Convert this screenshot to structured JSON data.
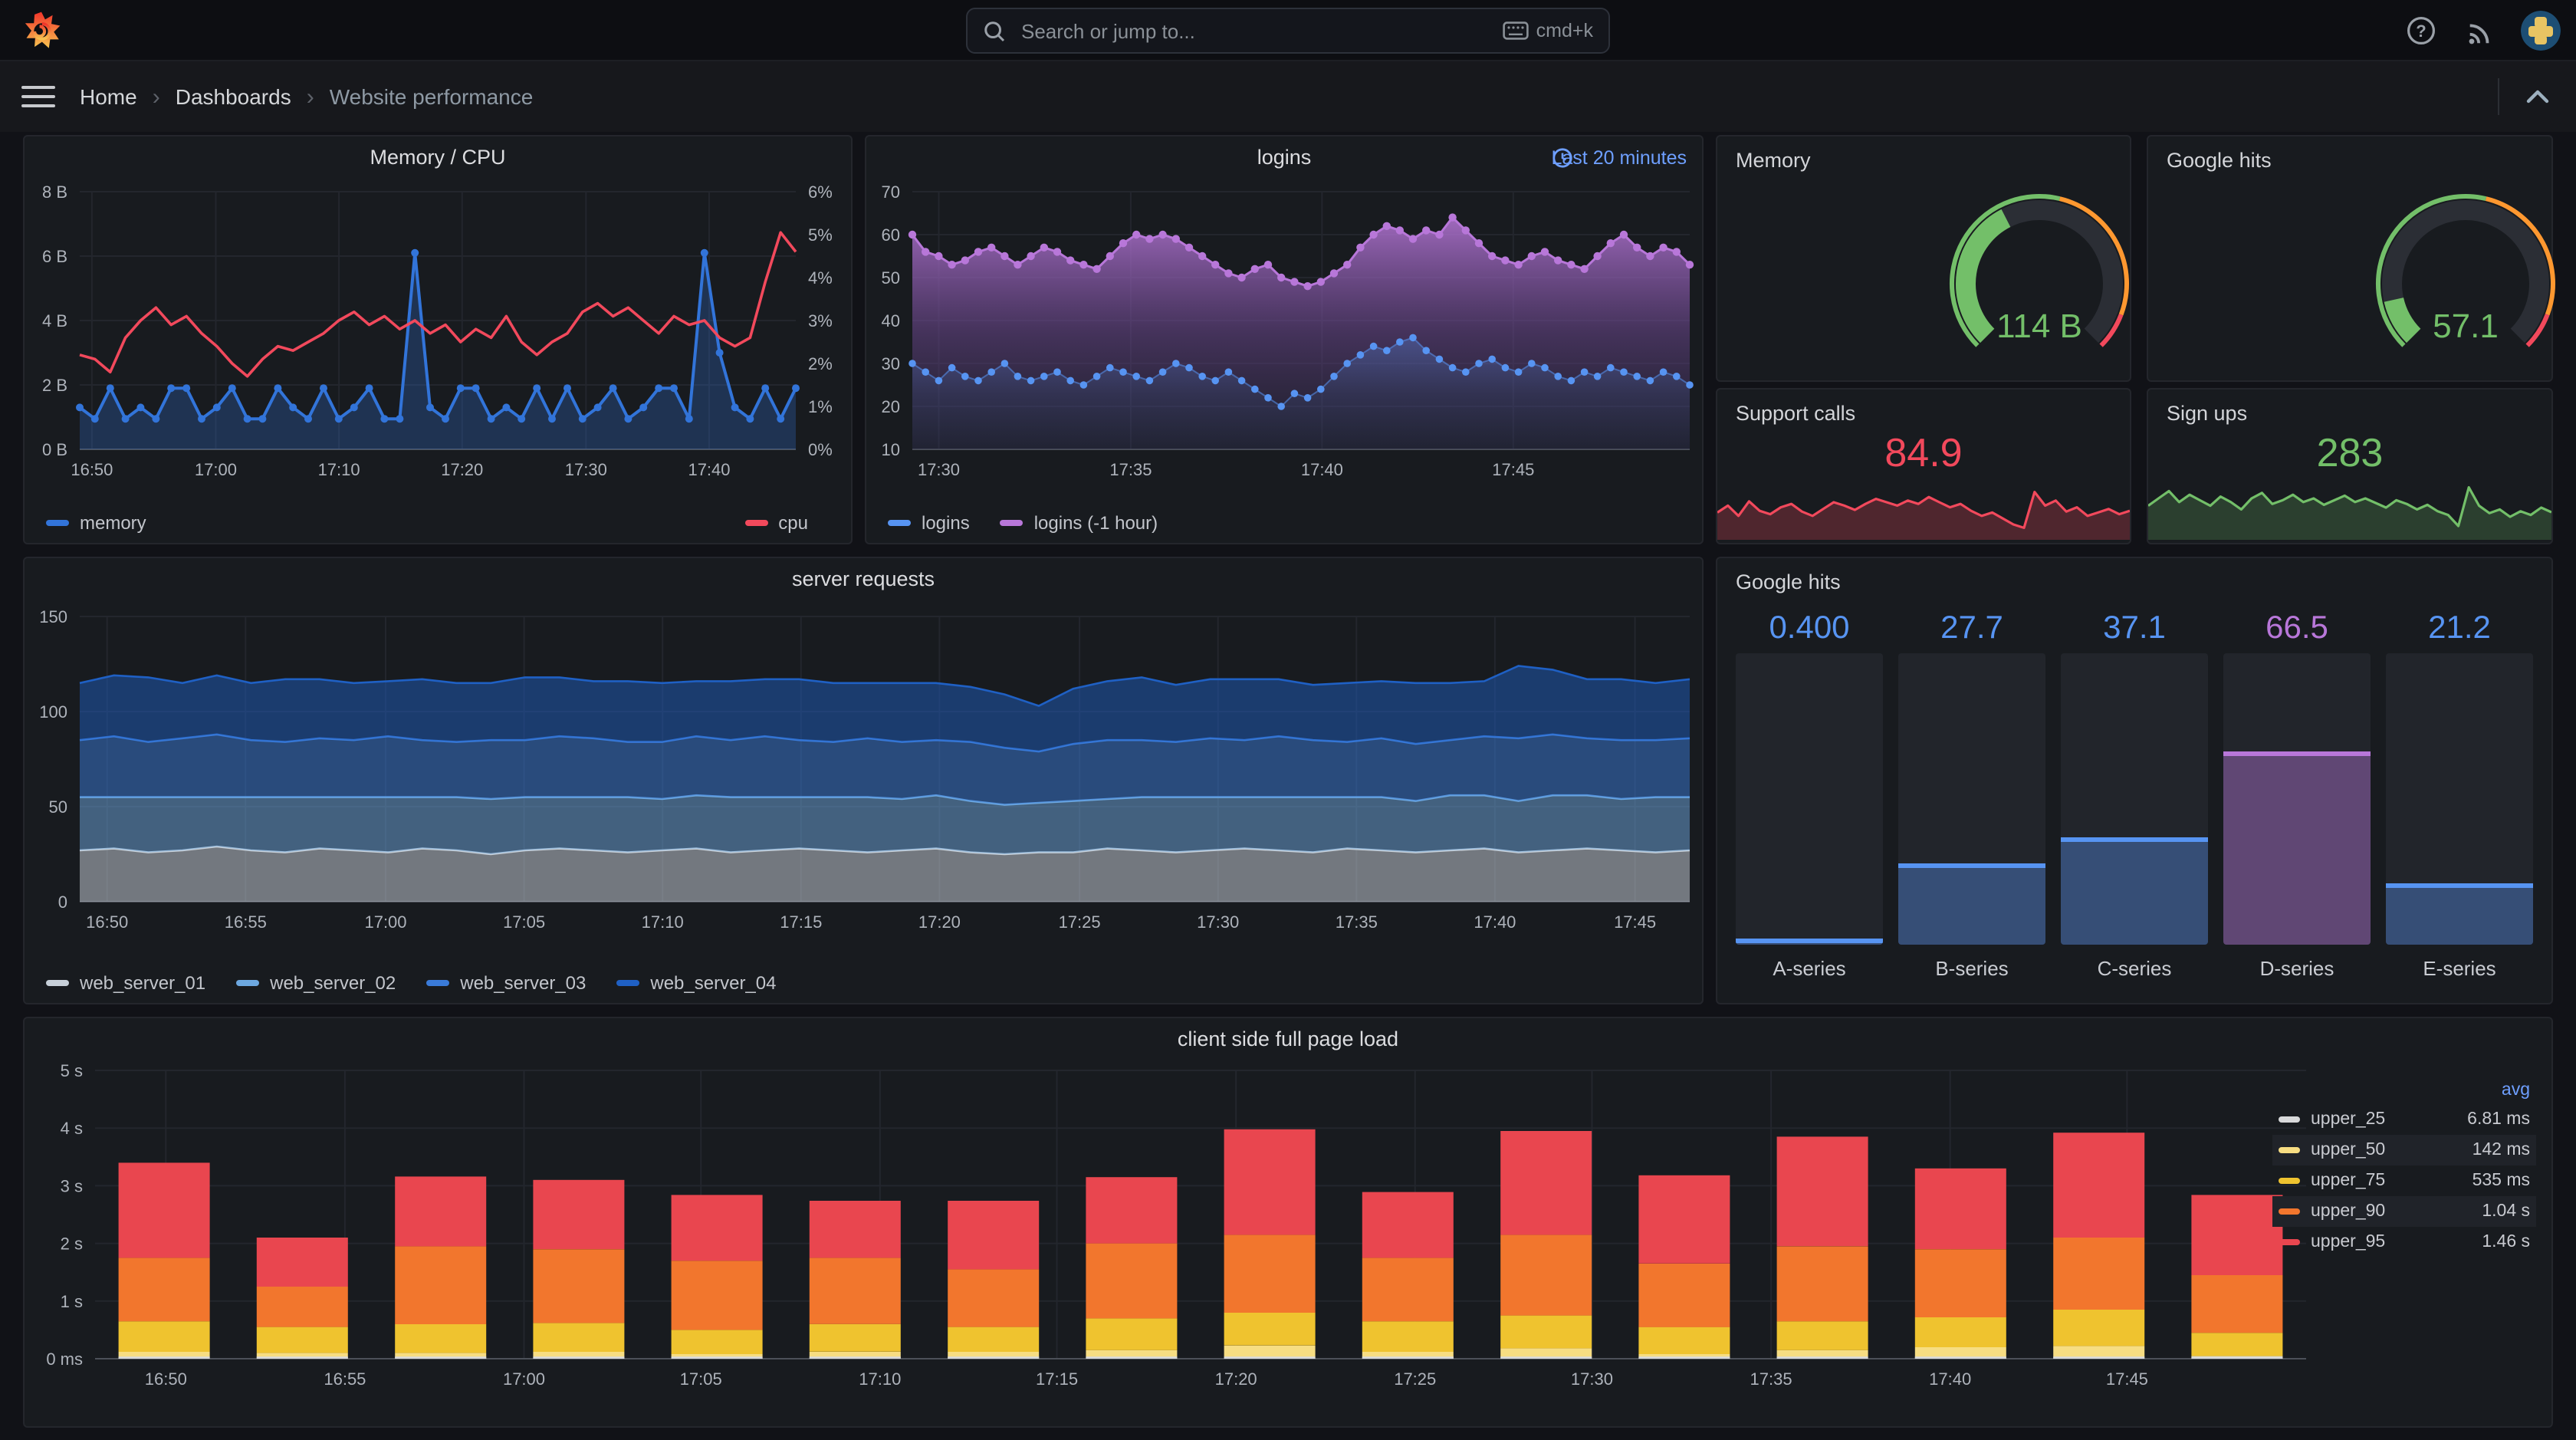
{
  "topbar": {
    "search_placeholder": "Search or jump to...",
    "shortcut": "cmd+k"
  },
  "breadcrumb": {
    "items": [
      "Home",
      "Dashboards",
      "Website performance"
    ]
  },
  "colors": {
    "blue": "#3274D9",
    "light_blue": "#5794F2",
    "red": "#F2495C",
    "green": "#73BF69",
    "orange": "#FF9830",
    "purple": "#B877D9",
    "panel": "#181B1F",
    "background": "#111217"
  },
  "chart_data": [
    {
      "id": "memcpu",
      "type": "line",
      "title": "Memory / CPU",
      "ylim": [
        0,
        8
      ],
      "yticks": [
        {
          "v": 8,
          "l": "8 B"
        },
        {
          "v": 6,
          "l": "6 B"
        },
        {
          "v": 4,
          "l": "4 B"
        },
        {
          "v": 2,
          "l": "2 B"
        },
        {
          "v": 0,
          "l": "0 B"
        }
      ],
      "y2lim": [
        0,
        6
      ],
      "y2ticks": [
        {
          "v": 6,
          "l": "6%"
        },
        {
          "v": 5,
          "l": "5%"
        },
        {
          "v": 4,
          "l": "4%"
        },
        {
          "v": 3,
          "l": "3%"
        },
        {
          "v": 2,
          "l": "2%"
        },
        {
          "v": 1,
          "l": "1%"
        },
        {
          "v": 0,
          "l": "0%"
        }
      ],
      "xticks": [
        {
          "f": 0.017,
          "l": "16:50"
        },
        {
          "f": 0.19,
          "l": "17:00"
        },
        {
          "f": 0.362,
          "l": "17:10"
        },
        {
          "f": 0.534,
          "l": "17:20"
        },
        {
          "f": 0.707,
          "l": "17:30"
        },
        {
          "f": 0.879,
          "l": "17:40"
        }
      ],
      "series": [
        {
          "name": "memory",
          "color": "#3274D9",
          "axis": 1,
          "dots": true,
          "lw": 2,
          "fill": "rgba(50,116,217,0.28)",
          "values": [
            1.3,
            0.95,
            1.9,
            0.95,
            1.3,
            0.95,
            1.9,
            1.9,
            0.95,
            1.3,
            1.9,
            0.95,
            0.95,
            1.9,
            1.3,
            0.95,
            1.9,
            0.95,
            1.3,
            1.9,
            0.95,
            0.95,
            6.1,
            1.3,
            0.95,
            1.9,
            1.9,
            0.95,
            1.3,
            0.95,
            1.9,
            0.95,
            1.9,
            0.95,
            1.3,
            1.9,
            0.95,
            1.3,
            1.9,
            1.9,
            0.95,
            6.1,
            3.0,
            1.3,
            0.95,
            1.9,
            0.95,
            1.9
          ]
        },
        {
          "name": "cpu",
          "color": "#F2495C",
          "axis": 2,
          "lw": 1.8,
          "values": [
            2.2,
            2.1,
            1.8,
            2.6,
            3.0,
            3.3,
            2.9,
            3.1,
            2.7,
            2.4,
            2.0,
            1.7,
            2.1,
            2.4,
            2.3,
            2.5,
            2.7,
            3.0,
            3.2,
            2.9,
            3.1,
            2.8,
            3.0,
            2.7,
            2.9,
            2.5,
            2.8,
            2.6,
            3.1,
            2.5,
            2.2,
            2.5,
            2.7,
            3.2,
            3.4,
            3.1,
            3.3,
            3.0,
            2.7,
            3.1,
            2.9,
            3.0,
            2.6,
            2.4,
            2.6,
            3.9,
            5.05,
            4.6
          ]
        }
      ],
      "legend_left": [
        {
          "label": "memory",
          "color": "#3274D9"
        }
      ],
      "legend_right": [
        {
          "label": "cpu",
          "color": "#F2495C"
        }
      ]
    },
    {
      "id": "logins",
      "type": "line",
      "title": "logins",
      "timerange": "Last 20 minutes",
      "ylim": [
        10,
        70
      ],
      "yticks": [
        {
          "v": 70,
          "l": "70"
        },
        {
          "v": 60,
          "l": "60"
        },
        {
          "v": 50,
          "l": "50"
        },
        {
          "v": 40,
          "l": "40"
        },
        {
          "v": 30,
          "l": "30"
        },
        {
          "v": 20,
          "l": "20"
        },
        {
          "v": 10,
          "l": "10"
        }
      ],
      "xticks": [
        {
          "f": 0.034,
          "l": "17:30"
        },
        {
          "f": 0.281,
          "l": "17:35"
        },
        {
          "f": 0.527,
          "l": "17:40"
        },
        {
          "f": 0.773,
          "l": "17:45"
        }
      ],
      "series": [
        {
          "name": "logins (-1 hour)",
          "color": "#B877D9",
          "dots": true,
          "r": 2.6,
          "lw": 1.5,
          "gradfill": [
            "rgba(184,119,217,0.85)",
            "rgba(105,70,140,0.55)",
            "rgba(45,40,70,0.35)"
          ],
          "values": [
            60,
            56,
            55,
            53,
            54,
            56,
            57,
            55,
            53,
            55,
            57,
            56,
            54,
            53,
            52,
            55,
            58,
            60,
            59,
            60,
            59,
            57,
            55,
            53,
            51,
            50,
            52,
            53,
            50,
            49,
            48,
            49,
            51,
            53,
            57,
            60,
            62,
            61,
            59,
            61,
            60,
            64,
            61,
            58,
            55,
            54,
            53,
            55,
            56,
            54,
            53,
            52,
            55,
            58,
            60,
            57,
            55,
            57,
            56,
            53
          ]
        },
        {
          "name": "logins",
          "color": "#5794F2",
          "dots": true,
          "r": 2.4,
          "lw": 1,
          "lo": 0.55,
          "gradfill": [
            "rgba(87,148,242,0.30)",
            "rgba(87,148,242,0.10)",
            "rgba(87,148,242,0.03)"
          ],
          "values": [
            30,
            28,
            26,
            29,
            27,
            26,
            28,
            30,
            27,
            26,
            27,
            28,
            26,
            25,
            27,
            29,
            28,
            27,
            26,
            28,
            30,
            29,
            27,
            26,
            28,
            26,
            24,
            22,
            20,
            23,
            22,
            24,
            27,
            30,
            32,
            34,
            33,
            35,
            36,
            33,
            31,
            29,
            28,
            30,
            31,
            29,
            28,
            30,
            29,
            27,
            26,
            28,
            27,
            29,
            28,
            27,
            26,
            28,
            27,
            25
          ]
        }
      ],
      "legend": [
        {
          "label": "logins",
          "color": "#5794F2"
        },
        {
          "label": "logins (-1 hour)",
          "color": "#B877D9"
        }
      ]
    },
    {
      "id": "server",
      "type": "stacked-area",
      "title": "server requests",
      "ylim": [
        0,
        150
      ],
      "yticks": [
        {
          "v": 150,
          "l": "150"
        },
        {
          "v": 100,
          "l": "100"
        },
        {
          "v": 50,
          "l": "50"
        },
        {
          "v": 0,
          "l": "0"
        }
      ],
      "xticks": [
        {
          "f": 0.017,
          "l": "16:50"
        },
        {
          "f": 0.103,
          "l": "16:55"
        },
        {
          "f": 0.19,
          "l": "17:00"
        },
        {
          "f": 0.276,
          "l": "17:05"
        },
        {
          "f": 0.362,
          "l": "17:10"
        },
        {
          "f": 0.448,
          "l": "17:15"
        },
        {
          "f": 0.534,
          "l": "17:20"
        },
        {
          "f": 0.621,
          "l": "17:25"
        },
        {
          "f": 0.707,
          "l": "17:30"
        },
        {
          "f": 0.793,
          "l": "17:35"
        },
        {
          "f": 0.879,
          "l": "17:40"
        },
        {
          "f": 0.966,
          "l": "17:45"
        }
      ],
      "series": [
        {
          "name": "web_server_01",
          "color": "#C7D0D9",
          "fill": "rgba(199,208,217,0.52)",
          "values": [
            27,
            28,
            26,
            27,
            29,
            27,
            26,
            28,
            27,
            26,
            28,
            27,
            25,
            27,
            28,
            27,
            26,
            27,
            28,
            26,
            27,
            28,
            27,
            26,
            27,
            28,
            26,
            25,
            26,
            26,
            28,
            27,
            26,
            27,
            28,
            27,
            26,
            28,
            27,
            26,
            27,
            28,
            26,
            27,
            28,
            27,
            26,
            27
          ]
        },
        {
          "name": "web_server_02",
          "color": "#6DA8E0",
          "fill": "rgba(109,168,224,0.5)",
          "values": [
            28,
            27,
            29,
            28,
            26,
            28,
            29,
            27,
            28,
            29,
            27,
            28,
            29,
            28,
            27,
            28,
            29,
            27,
            28,
            29,
            28,
            27,
            28,
            29,
            27,
            28,
            27,
            26,
            26,
            27,
            26,
            28,
            29,
            28,
            27,
            28,
            29,
            27,
            28,
            27,
            29,
            28,
            27,
            29,
            28,
            27,
            29,
            28
          ]
        },
        {
          "name": "web_server_03",
          "color": "#3A7BD9",
          "fill": "rgba(58,123,217,0.5)",
          "values": [
            30,
            32,
            29,
            31,
            33,
            30,
            29,
            31,
            30,
            32,
            30,
            29,
            31,
            30,
            32,
            31,
            29,
            30,
            31,
            30,
            32,
            30,
            29,
            31,
            30,
            29,
            31,
            30,
            27,
            30,
            31,
            30,
            29,
            31,
            30,
            32,
            30,
            29,
            31,
            30,
            29,
            31,
            33,
            32,
            30,
            31,
            30,
            31
          ]
        },
        {
          "name": "web_server_04",
          "color": "#1F60C4",
          "fill": "rgba(31,96,196,0.48)",
          "values": [
            30,
            32,
            34,
            29,
            31,
            30,
            33,
            31,
            30,
            29,
            32,
            31,
            30,
            33,
            31,
            30,
            32,
            31,
            29,
            31,
            30,
            32,
            31,
            29,
            31,
            30,
            29,
            28,
            24,
            29,
            31,
            33,
            30,
            31,
            32,
            30,
            29,
            31,
            30,
            32,
            30,
            29,
            38,
            34,
            31,
            32,
            30,
            31
          ]
        }
      ],
      "legend": [
        {
          "label": "web_server_01",
          "color": "#C7D0D9"
        },
        {
          "label": "web_server_02",
          "color": "#6DA8E0"
        },
        {
          "label": "web_server_03",
          "color": "#3A7BD9"
        },
        {
          "label": "web_server_04",
          "color": "#1F60C4"
        }
      ]
    },
    {
      "id": "gauge-memory",
      "type": "gauge",
      "title": "Memory",
      "value": "114 B",
      "percent": 40,
      "color": "#73BF69",
      "thresholds": [
        {
          "to": 55,
          "color": "#73BF69"
        },
        {
          "to": 91,
          "color": "#FF9830"
        },
        {
          "to": 100,
          "color": "#F2495C"
        }
      ]
    },
    {
      "id": "gauge-google",
      "type": "gauge",
      "title": "Google hits",
      "value": "57.1",
      "percent": 12,
      "color": "#73BF69",
      "thresholds": [
        {
          "to": 55,
          "color": "#73BF69"
        },
        {
          "to": 91,
          "color": "#FF9830"
        },
        {
          "to": 100,
          "color": "#F2495C"
        }
      ]
    },
    {
      "id": "stat-support",
      "type": "stat-sparkline",
      "title": "Support calls",
      "value": "84.9",
      "color": "#F2495C",
      "fill": "rgba(242,73,92,0.25)",
      "ylim": [
        30,
        100
      ],
      "values": [
        62,
        70,
        58,
        75,
        64,
        60,
        68,
        72,
        63,
        58,
        66,
        74,
        70,
        65,
        72,
        78,
        74,
        70,
        76,
        72,
        80,
        74,
        68,
        72,
        64,
        58,
        62,
        55,
        48,
        44,
        86,
        70,
        76,
        63,
        68,
        58,
        62,
        66,
        60,
        64
      ]
    },
    {
      "id": "stat-signups",
      "type": "stat-sparkline",
      "title": "Sign ups",
      "value": "283",
      "color": "#73BF69",
      "fill": "rgba(115,191,105,0.22)",
      "ylim": [
        15,
        80
      ],
      "values": [
        52,
        60,
        68,
        56,
        64,
        58,
        52,
        62,
        56,
        48,
        60,
        66,
        54,
        58,
        64,
        56,
        60,
        53,
        58,
        63,
        56,
        60,
        55,
        50,
        58,
        54,
        48,
        53,
        46,
        42,
        30,
        72,
        52,
        44,
        48,
        40,
        46,
        42,
        50,
        45
      ]
    },
    {
      "id": "bargauge",
      "type": "bar",
      "title": "Google hits",
      "max": 100,
      "bars": [
        {
          "label": "A-series",
          "display": "0.400",
          "value": 0.4,
          "color": "#5794F2",
          "body": "rgba(87,148,242,0.38)"
        },
        {
          "label": "B-series",
          "display": "27.7",
          "value": 27.7,
          "color": "#5794F2",
          "body": "rgba(87,148,242,0.38)"
        },
        {
          "label": "C-series",
          "display": "37.1",
          "value": 37.1,
          "color": "#5794F2",
          "body": "rgba(87,148,242,0.38)"
        },
        {
          "label": "D-series",
          "display": "66.5",
          "value": 66.5,
          "color": "#B877D9",
          "body": "rgba(184,119,217,0.42)"
        },
        {
          "label": "E-series",
          "display": "21.2",
          "value": 21.2,
          "color": "#5794F2",
          "body": "rgba(87,148,242,0.38)"
        }
      ]
    },
    {
      "id": "pageload",
      "type": "stacked-bar",
      "title": "client side full page load",
      "ylim": [
        0,
        5
      ],
      "yticks": [
        {
          "v": 5,
          "l": "5 s"
        },
        {
          "v": 4,
          "l": "4 s"
        },
        {
          "v": 3,
          "l": "3 s"
        },
        {
          "v": 2,
          "l": "2 s"
        },
        {
          "v": 1,
          "l": "1 s"
        },
        {
          "v": 0,
          "l": "0 ms"
        }
      ],
      "xticks": [
        {
          "f": 0.032,
          "l": "16:50"
        },
        {
          "f": 0.113,
          "l": "16:55"
        },
        {
          "f": 0.194,
          "l": "17:00"
        },
        {
          "f": 0.274,
          "l": "17:05"
        },
        {
          "f": 0.355,
          "l": "17:10"
        },
        {
          "f": 0.435,
          "l": "17:15"
        },
        {
          "f": 0.516,
          "l": "17:20"
        },
        {
          "f": 0.597,
          "l": "17:25"
        },
        {
          "f": 0.677,
          "l": "17:30"
        },
        {
          "f": 0.758,
          "l": "17:35"
        },
        {
          "f": 0.839,
          "l": "17:40"
        },
        {
          "f": 0.919,
          "l": "17:45"
        }
      ],
      "colors": {
        "u25": "#D8D9DA",
        "u50": "#F7DD82",
        "u75": "#EFC32F",
        "u90": "#F2762D",
        "u95": "#E9464F"
      },
      "stacks": {
        "u50": [
          0.12,
          0.1,
          0.1,
          0.12,
          0.08,
          0.12,
          0.12,
          0.15,
          0.23,
          0.12,
          0.18,
          0.08,
          0.15,
          0.2,
          0.22,
          0.05
        ],
        "u75": [
          0.65,
          0.55,
          0.6,
          0.62,
          0.5,
          0.6,
          0.55,
          0.7,
          0.8,
          0.65,
          0.75,
          0.55,
          0.65,
          0.72,
          0.85,
          0.45
        ],
        "u90": [
          1.75,
          1.25,
          1.95,
          1.9,
          1.7,
          1.75,
          1.55,
          2.0,
          2.15,
          1.75,
          2.15,
          1.65,
          1.95,
          1.9,
          2.1,
          1.45
        ],
        "u95": [
          3.4,
          2.1,
          3.16,
          3.1,
          2.84,
          2.74,
          2.74,
          3.15,
          3.98,
          2.89,
          3.95,
          3.18,
          3.85,
          3.3,
          3.92,
          2.84
        ]
      },
      "legend_table": {
        "header": "avg",
        "rows": [
          {
            "name": "upper_25",
            "color": "#D8D9DA",
            "value": "6.81 ms",
            "alt": false
          },
          {
            "name": "upper_50",
            "color": "#F7DD82",
            "value": "142 ms",
            "alt": true
          },
          {
            "name": "upper_75",
            "color": "#EFC32F",
            "value": "535 ms",
            "alt": false
          },
          {
            "name": "upper_90",
            "color": "#F2762D",
            "value": "1.04 s",
            "alt": true
          },
          {
            "name": "upper_95",
            "color": "#E9464F",
            "value": "1.46 s",
            "alt": false
          }
        ]
      }
    }
  ]
}
